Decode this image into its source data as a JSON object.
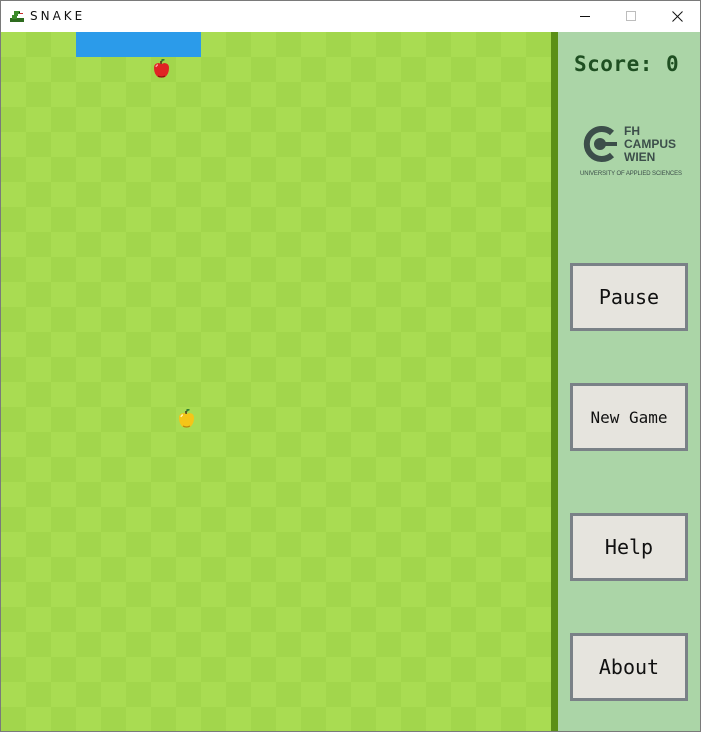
{
  "window": {
    "title": "SNAKE",
    "app_icon": "snake-icon",
    "controls": [
      "minimize-icon",
      "maximize-icon",
      "close-icon"
    ]
  },
  "board": {
    "grid_cols": 22,
    "grid_rows": 28,
    "snake": {
      "color": "#2b9bea",
      "row": 0,
      "col_start": 3,
      "length": 5
    },
    "fruits": [
      {
        "kind": "red-apple-icon",
        "row": 1,
        "col": 6
      },
      {
        "kind": "yellow-apple-icon",
        "row": 15,
        "col": 7
      }
    ],
    "colors": {
      "light": "#a9dc52",
      "dark": "#a2d64c",
      "divider": "#5b8f16"
    }
  },
  "sidebar": {
    "score_label": "Score: 0",
    "logo": {
      "line1": "FH",
      "line2": "CAMPUS",
      "line3": "WIEN",
      "subtitle": "UNIVERSITY OF APPLIED SCIENCES"
    },
    "buttons": {
      "pause": "Pause",
      "new_game": "New Game",
      "help": "Help",
      "about": "About"
    },
    "colors": {
      "panel": "#abd5a7",
      "score": "#1f4f22",
      "button_bg": "#e6e4de",
      "button_border": "#7a8187"
    }
  }
}
